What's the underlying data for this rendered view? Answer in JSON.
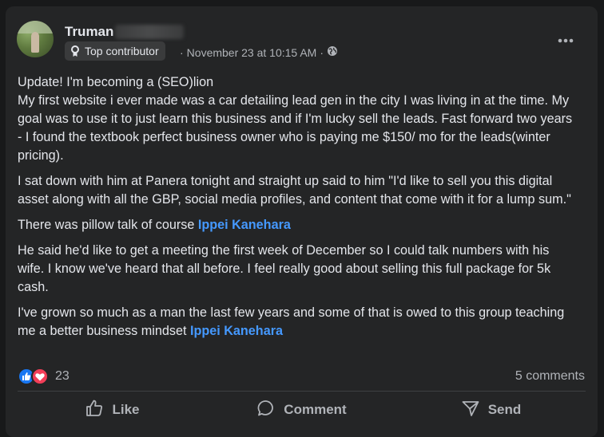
{
  "post": {
    "author": "Truman",
    "badge": "Top contributor",
    "timestamp": "November 23 at 10:15 AM",
    "separator": "·",
    "audience_icon": "globe-icon",
    "more_icon": "more-options-icon",
    "paragraphs": [
      [
        "Update! I'm becoming a (SEO)lion"
      ],
      [
        "My first website i ever made was a car detailing lead gen in the city I was living in at the time. My goal was to use it to just learn this business and if I'm lucky sell the leads. Fast forward two years - I found the textbook perfect business owner who is paying me $150/ mo for the leads(winter pricing)."
      ],
      [
        "I sat down with him at Panera tonight and straight up said to him \"I'd like to sell you this digital asset along with all the GBP, social media profiles, and content that come with it for a lump sum.\""
      ],
      [
        "There was pillow talk of course "
      ],
      [
        "He said he'd like to get a meeting the first week of December so I could talk numbers with his wife. I know we've heard that all before. I feel really good about selling this full package for 5k cash."
      ],
      [
        "I've grown so much as a man the last few years and some of that is owed to this group teaching me a better business mindset "
      ]
    ],
    "mention": "Ippei Kanehara"
  },
  "engagement": {
    "reaction_count": "23",
    "comments": "5 comments"
  },
  "actions": {
    "like": "Like",
    "comment": "Comment",
    "send": "Send"
  },
  "colors": {
    "background": "#18191a",
    "card": "#242526",
    "mention": "#4599ff",
    "like_blue": "#1877f2",
    "love_red": "#f33e58"
  }
}
